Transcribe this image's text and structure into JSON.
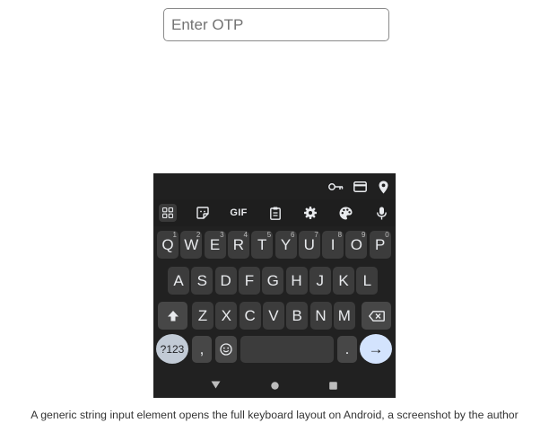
{
  "otp_input": {
    "placeholder": "Enter OTP",
    "value": ""
  },
  "keyboard": {
    "status_icons": [
      "key-icon",
      "card-icon",
      "location-icon"
    ],
    "toolbar": {
      "icons": [
        "apps-grid-icon",
        "sticker-icon",
        "gif-button",
        "clipboard-icon",
        "settings-icon",
        "theme-palette-icon",
        "microphone-icon"
      ],
      "gif_label": "GIF"
    },
    "row1": [
      {
        "label": "Q",
        "hint": "1"
      },
      {
        "label": "W",
        "hint": "2"
      },
      {
        "label": "E",
        "hint": "3"
      },
      {
        "label": "R",
        "hint": "4"
      },
      {
        "label": "T",
        "hint": "5"
      },
      {
        "label": "Y",
        "hint": "6"
      },
      {
        "label": "U",
        "hint": "7"
      },
      {
        "label": "I",
        "hint": "8"
      },
      {
        "label": "O",
        "hint": "9"
      },
      {
        "label": "P",
        "hint": "0"
      }
    ],
    "row2": [
      "A",
      "S",
      "D",
      "F",
      "G",
      "H",
      "J",
      "K",
      "L"
    ],
    "row3": [
      "Z",
      "X",
      "C",
      "V",
      "B",
      "N",
      "M"
    ],
    "symbols_label": "?123",
    "comma_label": ",",
    "period_label": ".",
    "enter_glyph": "→",
    "nav_icons": [
      "back-triangle-icon",
      "home-circle-icon",
      "recents-square-icon"
    ],
    "colors": {
      "background": "#212121",
      "key": "#3c3c3c",
      "enter": "#d3e3fd",
      "symbols": "#c2cbd6"
    }
  },
  "caption": "A generic string input element opens the full keyboard layout on Android, a screenshot by the author"
}
